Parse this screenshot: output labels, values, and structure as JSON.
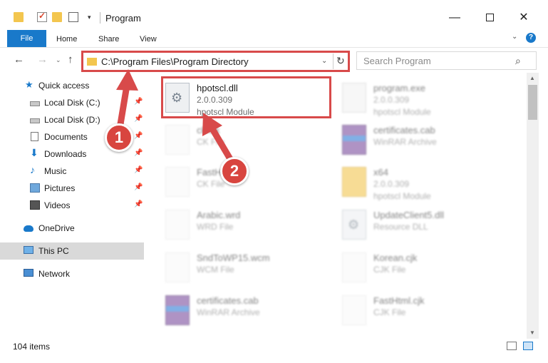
{
  "titlebar": {
    "title": "Program",
    "minimize_glyph": "—",
    "close_glyph": "✕",
    "dropdown_glyph": "▾"
  },
  "ribbon": {
    "tabs": [
      {
        "label": "File"
      },
      {
        "label": "Home"
      },
      {
        "label": "Share"
      },
      {
        "label": "View"
      }
    ],
    "chevron_glyph": "⌄",
    "help_glyph": "?"
  },
  "nav": {
    "back_glyph": "←",
    "forward_glyph": "→",
    "recent_glyph": "⌄",
    "up_glyph": "↑",
    "address": "C:\\Program Files\\Program Directory",
    "address_dropdown_glyph": "⌄",
    "refresh_glyph": "↻",
    "search_placeholder": "Search Program",
    "search_glyph": "⌕"
  },
  "sidebar": {
    "pin_glyph": "📌",
    "items": [
      {
        "label": "Quick access",
        "icon": "star-icon",
        "pinned": false
      },
      {
        "label": "Local Disk (C:)",
        "icon": "disk-icon",
        "pinned": true
      },
      {
        "label": "Local Disk (D:)",
        "icon": "disk-icon",
        "pinned": true
      },
      {
        "label": "Documents",
        "icon": "documents-icon",
        "pinned": true
      },
      {
        "label": "Downloads",
        "icon": "downloads-icon",
        "pinned": true
      },
      {
        "label": "Music",
        "icon": "music-icon",
        "pinned": true
      },
      {
        "label": "Pictures",
        "icon": "pictures-icon",
        "pinned": true
      },
      {
        "label": "Videos",
        "icon": "videos-icon",
        "pinned": true
      },
      {
        "label": "OneDrive",
        "icon": "onedrive-icon",
        "pinned": false
      },
      {
        "label": "This PC",
        "icon": "this-pc-icon",
        "pinned": false,
        "selected": true
      },
      {
        "label": "Network",
        "icon": "network-icon",
        "pinned": false
      }
    ]
  },
  "files": [
    {
      "name": "hpotscl.dll",
      "meta1": "2.0.0.309",
      "meta2": "hpotscl Module",
      "icon": "dll-file-icon",
      "highlighted": true
    },
    {
      "name": "program.exe",
      "meta1": "2.0.0.309",
      "meta2": "hpotscl Module",
      "icon": "exe-file-icon"
    },
    {
      "name": "ck.cjk",
      "meta1": "CK File",
      "meta2": "",
      "icon": "blank-file-icon"
    },
    {
      "name": "certificates.cab",
      "meta1": "WinRAR Archive",
      "meta2": "",
      "icon": "winrar-archive-icon"
    },
    {
      "name": "FastHtml.cjk",
      "meta1": "CK File",
      "meta2": "",
      "icon": "blank-file-icon"
    },
    {
      "name": "x64",
      "meta1": "2.0.0.309",
      "meta2": "hpotscl Module",
      "icon": "folder-icon"
    },
    {
      "name": "Arabic.wrd",
      "meta1": "WRD File",
      "meta2": "",
      "icon": "blank-file-icon"
    },
    {
      "name": "UpdateClient5.dll",
      "meta1": "Resource DLL",
      "meta2": "",
      "icon": "dll-file-icon"
    },
    {
      "name": "SndToWP15.wcm",
      "meta1": "WCM File",
      "meta2": "",
      "icon": "blank-file-icon"
    },
    {
      "name": "Korean.cjk",
      "meta1": "CJK File",
      "meta2": "",
      "icon": "blank-file-icon"
    },
    {
      "name": "certificates.cab",
      "meta1": "WinRAR Archive",
      "meta2": "",
      "icon": "winrar-archive-icon"
    },
    {
      "name": "FastHtml.cjk",
      "meta1": "CJK File",
      "meta2": "",
      "icon": "blank-file-icon"
    }
  ],
  "scrollbar": {
    "up_glyph": "▲",
    "down_glyph": "▼"
  },
  "status": {
    "item_count": "104 items"
  },
  "annotations": {
    "step1": "1",
    "step2": "2"
  },
  "colors": {
    "accent": "#1979ca",
    "annotation_red": "#d84a4a",
    "selected_bg": "#d9d9d9"
  }
}
